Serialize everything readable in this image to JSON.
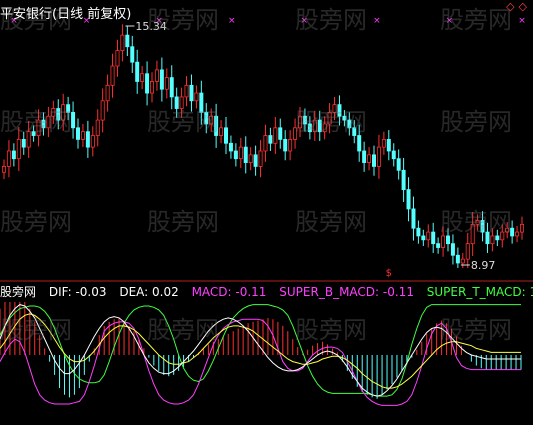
{
  "title": "平安银行(日线 前复权)",
  "corner_marks": "◇◇",
  "watermark": "股旁网",
  "legend": {
    "source": "股旁网",
    "dif": "DIF: -0.03",
    "dea": "DEA: 0.02",
    "macd": "MACD: -0.11",
    "super_b": "SUPER_B_MACD: -0.11",
    "super_t": "SUPER_T_MACD: 1.02"
  },
  "colors": {
    "up": "#ff3030",
    "down": "#54ffff",
    "dif": "#ffffff",
    "dea": "#ffff40",
    "super_b": "#ff40ff",
    "super_t": "#40ff40",
    "mark": "#ff40ff",
    "separator": "#b02020"
  },
  "chart_data": {
    "type": "candlestick",
    "price_labels": {
      "high": "15.34",
      "low": "8.97"
    },
    "high": 15.34,
    "low": 8.97,
    "top_marks": 8,
    "bottom_marks": 1,
    "closes": [
      11.6,
      12.0,
      11.8,
      12.3,
      12.1,
      12.5,
      12.4,
      12.8,
      12.6,
      12.9,
      13.1,
      12.8,
      13.2,
      13.0,
      12.6,
      12.3,
      12.5,
      12.1,
      12.4,
      12.8,
      13.3,
      13.7,
      14.2,
      14.6,
      15.0,
      14.7,
      14.3,
      13.8,
      14.0,
      13.5,
      13.8,
      14.1,
      13.6,
      13.9,
      13.4,
      13.1,
      13.4,
      13.7,
      13.3,
      13.5,
      13.0,
      12.7,
      12.9,
      12.4,
      12.6,
      12.2,
      12.0,
      11.8,
      12.1,
      11.7,
      11.9,
      11.6,
      12.0,
      12.4,
      12.2,
      12.6,
      12.3,
      12.0,
      12.3,
      12.6,
      12.9,
      12.7,
      12.5,
      12.8,
      12.5,
      12.7,
      13.0,
      13.2,
      12.9,
      12.8,
      12.6,
      12.4,
      12.0,
      11.7,
      11.9,
      11.6,
      12.1,
      12.3,
      12.0,
      11.8,
      11.5,
      11.0,
      10.5,
      10.0,
      9.8,
      9.7,
      9.9,
      9.6,
      9.5,
      9.8,
      9.6,
      9.3,
      9.1,
      9.2,
      9.6,
      10.1,
      10.2,
      9.9,
      9.6,
      9.8,
      9.7,
      9.9,
      10.0,
      9.8,
      9.9,
      10.1
    ],
    "macd_hist": [
      0.35,
      0.4,
      0.42,
      0.44,
      0.45,
      0.4,
      0.35,
      0.25,
      0.15,
      0.05,
      -0.05,
      -0.15,
      -0.25,
      -0.3,
      -0.32,
      -0.3,
      -0.25,
      -0.15,
      -0.05,
      0.05,
      0.15,
      0.22,
      0.25,
      0.27,
      0.28,
      0.26,
      0.22,
      0.18,
      0.12,
      0.05,
      -0.02,
      -0.08,
      -0.12,
      -0.15,
      -0.16,
      -0.15,
      -0.12,
      -0.09,
      -0.05,
      -0.02,
      0.02,
      0.05,
      0.08,
      0.1,
      0.12,
      0.14,
      0.16,
      0.18,
      0.2,
      0.22,
      0.24,
      0.25,
      0.26,
      0.27,
      0.28,
      0.27,
      0.25,
      0.22,
      0.18,
      0.12,
      0.06,
      0.01,
      0.04,
      0.07,
      0.09,
      0.1,
      0.08,
      0.05,
      0.02,
      -0.05,
      -0.12,
      -0.18,
      -0.24,
      -0.28,
      -0.3,
      -0.32,
      -0.33,
      -0.3,
      -0.26,
      -0.22,
      -0.17,
      -0.12,
      -0.07,
      -0.02,
      0.04,
      0.1,
      0.16,
      0.2,
      0.24,
      0.26,
      0.24,
      0.2,
      0.14,
      0.07,
      0.0,
      -0.05,
      -0.08,
      -0.1,
      -0.11,
      -0.11,
      -0.11,
      -0.11,
      -0.11,
      -0.11,
      -0.11,
      -0.11
    ],
    "dif": [
      0.12,
      0.22,
      0.3,
      0.35,
      0.38,
      0.37,
      0.33,
      0.28,
      0.2,
      0.12,
      0.04,
      -0.04,
      -0.1,
      -0.14,
      -0.14,
      -0.11,
      -0.06,
      0.0,
      0.07,
      0.14,
      0.2,
      0.25,
      0.28,
      0.29,
      0.28,
      0.25,
      0.2,
      0.14,
      0.07,
      0.0,
      -0.06,
      -0.1,
      -0.13,
      -0.14,
      -0.14,
      -0.12,
      -0.09,
      -0.05,
      -0.01,
      0.03,
      0.08,
      0.13,
      0.18,
      0.22,
      0.25,
      0.27,
      0.28,
      0.27,
      0.25,
      0.22,
      0.18,
      0.13,
      0.08,
      0.03,
      -0.02,
      -0.06,
      -0.09,
      -0.11,
      -0.12,
      -0.12,
      -0.11,
      -0.09,
      -0.06,
      -0.03,
      0.0,
      0.02,
      0.03,
      0.02,
      0.0,
      -0.04,
      -0.09,
      -0.15,
      -0.2,
      -0.25,
      -0.28,
      -0.3,
      -0.31,
      -0.3,
      -0.27,
      -0.23,
      -0.18,
      -0.12,
      -0.06,
      0.0,
      0.06,
      0.12,
      0.17,
      0.2,
      0.21,
      0.2,
      0.17,
      0.13,
      0.09,
      0.05,
      0.02,
      0.0,
      -0.01,
      -0.02,
      -0.03,
      -0.03,
      -0.03,
      -0.03,
      -0.03,
      -0.03,
      -0.03,
      -0.03
    ],
    "dea": [
      0.05,
      0.1,
      0.16,
      0.22,
      0.27,
      0.3,
      0.31,
      0.3,
      0.27,
      0.23,
      0.18,
      0.12,
      0.06,
      0.01,
      -0.03,
      -0.05,
      -0.05,
      -0.04,
      -0.01,
      0.03,
      0.08,
      0.13,
      0.17,
      0.2,
      0.22,
      0.22,
      0.21,
      0.19,
      0.16,
      0.12,
      0.08,
      0.04,
      0.0,
      -0.03,
      -0.06,
      -0.07,
      -0.07,
      -0.06,
      -0.05,
      -0.02,
      0.01,
      0.05,
      0.09,
      0.13,
      0.16,
      0.19,
      0.21,
      0.22,
      0.22,
      0.21,
      0.2,
      0.18,
      0.15,
      0.12,
      0.09,
      0.06,
      0.03,
      0.0,
      -0.03,
      -0.05,
      -0.06,
      -0.07,
      -0.07,
      -0.06,
      -0.05,
      -0.03,
      -0.02,
      -0.01,
      -0.01,
      -0.02,
      -0.04,
      -0.07,
      -0.1,
      -0.14,
      -0.17,
      -0.2,
      -0.22,
      -0.24,
      -0.25,
      -0.25,
      -0.24,
      -0.22,
      -0.19,
      -0.16,
      -0.12,
      -0.08,
      -0.04,
      0.0,
      0.04,
      0.07,
      0.09,
      0.1,
      0.1,
      0.09,
      0.08,
      0.07,
      0.05,
      0.04,
      0.03,
      0.02,
      0.02,
      0.02,
      0.02,
      0.02,
      0.02,
      0.02
    ],
    "super_b": [
      -0.05,
      0.02,
      0.08,
      0.12,
      0.1,
      0.02,
      -0.1,
      -0.22,
      -0.3,
      -0.34,
      -0.36,
      -0.37,
      -0.37,
      -0.37,
      -0.37,
      -0.36,
      -0.35,
      -0.3,
      -0.2,
      -0.08,
      0.05,
      0.18,
      0.22,
      0.24,
      0.25,
      0.25,
      0.24,
      0.2,
      0.12,
      0.0,
      -0.12,
      -0.22,
      -0.3,
      -0.34,
      -0.36,
      -0.37,
      -0.37,
      -0.36,
      -0.34,
      -0.3,
      -0.22,
      -0.12,
      -0.02,
      0.08,
      0.15,
      0.2,
      0.23,
      0.25,
      0.26,
      0.27,
      0.27,
      0.27,
      0.27,
      0.26,
      0.22,
      0.15,
      0.05,
      -0.05,
      -0.1,
      -0.12,
      -0.12,
      -0.1,
      -0.05,
      0.0,
      0.03,
      0.05,
      0.06,
      0.06,
      0.05,
      0.02,
      -0.05,
      -0.12,
      -0.2,
      -0.27,
      -0.32,
      -0.35,
      -0.37,
      -0.38,
      -0.38,
      -0.38,
      -0.38,
      -0.37,
      -0.35,
      -0.3,
      -0.2,
      -0.08,
      0.05,
      0.16,
      0.22,
      0.24,
      0.2,
      0.1,
      -0.02,
      -0.08,
      -0.1,
      -0.11,
      -0.11,
      -0.11,
      -0.11,
      -0.11,
      -0.11,
      -0.11,
      -0.11,
      -0.11,
      -0.11,
      -0.11
    ],
    "super_t": [
      0.15,
      0.22,
      0.28,
      0.32,
      0.35,
      0.36,
      0.37,
      0.37,
      0.36,
      0.33,
      0.28,
      0.2,
      0.1,
      0.0,
      -0.08,
      -0.14,
      -0.18,
      -0.2,
      -0.21,
      -0.21,
      -0.2,
      -0.15,
      -0.05,
      0.06,
      0.16,
      0.24,
      0.3,
      0.34,
      0.36,
      0.37,
      0.37,
      0.36,
      0.34,
      0.3,
      0.22,
      0.12,
      0.0,
      -0.1,
      -0.16,
      -0.19,
      -0.2,
      -0.18,
      -0.12,
      -0.04,
      0.05,
      0.14,
      0.22,
      0.28,
      0.32,
      0.35,
      0.37,
      0.38,
      0.38,
      0.38,
      0.38,
      0.37,
      0.36,
      0.34,
      0.3,
      0.22,
      0.12,
      0.02,
      -0.08,
      -0.16,
      -0.22,
      -0.26,
      -0.28,
      -0.29,
      -0.29,
      -0.29,
      -0.29,
      -0.29,
      -0.29,
      -0.29,
      -0.29,
      -0.3,
      -0.31,
      -0.31,
      -0.31,
      -0.3,
      -0.26,
      -0.18,
      -0.06,
      0.08,
      0.2,
      0.3,
      0.36,
      0.38,
      0.38,
      0.38,
      0.38,
      0.38,
      0.38,
      0.38,
      0.38,
      0.38,
      0.38,
      0.38,
      0.38,
      0.38,
      0.38,
      0.38,
      0.38,
      0.38,
      0.38,
      0.38
    ]
  }
}
